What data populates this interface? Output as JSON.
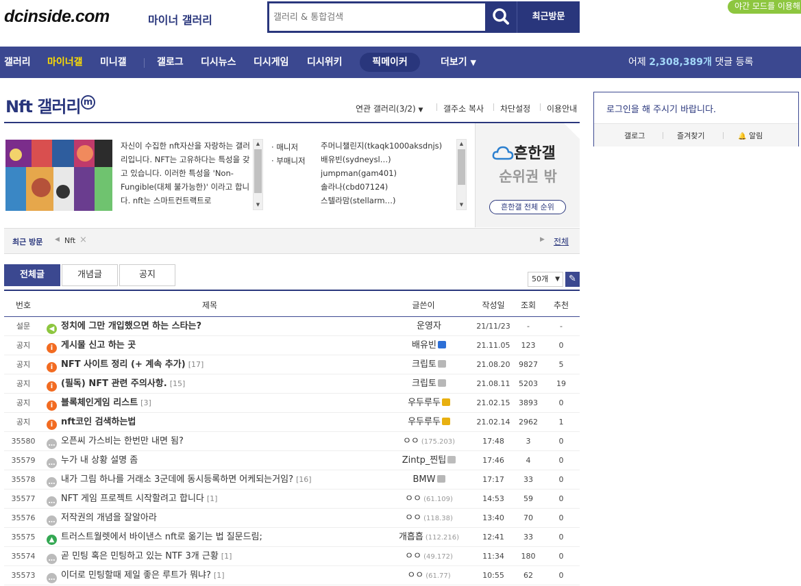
{
  "header": {
    "logo": "dcinside.com",
    "logo_sub": "마이너 갤러리",
    "search_placeholder": "갤러리 & 통합검색",
    "recent_visit_btn": "최근방문",
    "night_mode": "야간 모드를 이용해"
  },
  "nav": {
    "items": [
      "갤러리",
      "마이너갤",
      "미니갤",
      "갤로그",
      "디시뉴스",
      "디시게임",
      "디시위키",
      "픽메이커",
      "더보기"
    ],
    "stat_prefix": "어제",
    "stat_count": "2,308,389개",
    "stat_suffix": "댓글 등록"
  },
  "gallery": {
    "title": "Nft 갤러리",
    "badge": "m",
    "links": [
      "연관 갤러리(3/2)",
      "갤주소 복사",
      "차단설정",
      "이용안내"
    ],
    "description": "자신이 수집한 nft자산을 자랑하는 갤러리입니다. NFT는 고유하다는 특성을 갖고 있습니다. 이러한 특성을 'Non-Fungible(대체 불가능한)' 이라고 합니다. nft는 스마트컨트랙트로",
    "manager_label": "매니저",
    "sub_manager_label": "부매니저",
    "manager_names": [
      "주머니챌린지(tkaqk1000aksdnjs)",
      "배유빈(sydneysl…)",
      "jumpman(gam401)",
      "솔라나(cbd07124)",
      "스텔라맘(stellarm…)"
    ],
    "rank_title": "흔한갤",
    "rank_status": "순위권 밖",
    "rank_button": "흔한갤 전체 순위",
    "rank_help": "?",
    "recent_label": "최근 방문",
    "recent_item": "Nft",
    "recent_all": "전체"
  },
  "tabs": [
    "전체글",
    "개념글",
    "공지"
  ],
  "list_count": "50개",
  "table": {
    "headers": [
      "번호",
      "제목",
      "글쓴이",
      "작성일",
      "조회",
      "추천"
    ],
    "rows": [
      {
        "num": "설문",
        "icon": "survey",
        "title": "정치에 그만 개입했으면 하는 스타는?",
        "comments": "",
        "writer": "운영자",
        "ip": "",
        "badge": "",
        "date": "21/11/23",
        "views": "-",
        "recs": "-",
        "bold": true
      },
      {
        "num": "공지",
        "icon": "notice",
        "title": "게시물 신고 하는 곳",
        "comments": "",
        "writer": "배유빈",
        "ip": "",
        "badge": "blue",
        "date": "21.11.05",
        "views": "123",
        "recs": "0",
        "bold": true
      },
      {
        "num": "공지",
        "icon": "notice",
        "title": "NFT 사이트 정리 (+ 계속 추가)",
        "comments": "[17]",
        "writer": "크립토",
        "ip": "",
        "badge": "gray",
        "date": "21.08.20",
        "views": "9827",
        "recs": "5",
        "bold": true
      },
      {
        "num": "공지",
        "icon": "notice",
        "title": "(필독) NFT 관련 주의사항.",
        "comments": "[15]",
        "writer": "크립토",
        "ip": "",
        "badge": "gray",
        "date": "21.08.11",
        "views": "5203",
        "recs": "19",
        "bold": true
      },
      {
        "num": "공지",
        "icon": "notice",
        "title": "블록체인게임 리스트",
        "comments": "[3]",
        "writer": "우두루두",
        "ip": "",
        "badge": "gold",
        "date": "21.02.15",
        "views": "3893",
        "recs": "0",
        "bold": true
      },
      {
        "num": "공지",
        "icon": "notice",
        "title": "nft코인 검색하는법",
        "comments": "",
        "writer": "우두루두",
        "ip": "",
        "badge": "gold",
        "date": "21.02.14",
        "views": "2962",
        "recs": "1",
        "bold": true
      },
      {
        "num": "35580",
        "icon": "post",
        "title": "오픈씨 가스비는 한번만 내면 됨?",
        "comments": "",
        "writer": "ㅇㅇ",
        "ip": "(175.203)",
        "badge": "",
        "date": "17:48",
        "views": "3",
        "recs": "0",
        "bold": false
      },
      {
        "num": "35579",
        "icon": "post",
        "title": "누가 내 상황 설명 좀",
        "comments": "",
        "writer": "Zintp_찐팁",
        "ip": "",
        "badge": "gray2",
        "date": "17:46",
        "views": "4",
        "recs": "0",
        "bold": false
      },
      {
        "num": "35578",
        "icon": "post",
        "title": "내가 그림 하나를 거래소 3군데에 동시등록하면 어케되는거임?",
        "comments": "[16]",
        "writer": "BMW",
        "ip": "",
        "badge": "gray",
        "date": "17:17",
        "views": "33",
        "recs": "0",
        "bold": false
      },
      {
        "num": "35577",
        "icon": "post",
        "title": "NFT 게임 프로젝트 시작할려고 합니다",
        "comments": "[1]",
        "writer": "ㅇㅇ",
        "ip": "(61.109)",
        "badge": "",
        "date": "14:53",
        "views": "59",
        "recs": "0",
        "bold": false
      },
      {
        "num": "35576",
        "icon": "post",
        "title": "저작권의 개념을 잘알아라",
        "comments": "",
        "writer": "ㅇㅇ",
        "ip": "(118.38)",
        "badge": "",
        "date": "13:40",
        "views": "70",
        "recs": "0",
        "bold": false
      },
      {
        "num": "35575",
        "icon": "image",
        "title": "트러스트월렛에서 바이낸스 nft로 옮기는 법 질문드림;",
        "comments": "",
        "writer": "개흡흡",
        "ip": "(112.216)",
        "badge": "",
        "date": "12:41",
        "views": "33",
        "recs": "0",
        "bold": false
      },
      {
        "num": "35574",
        "icon": "post",
        "title": "곧 민팅 혹은 민팅하고 있는 NTF 3개 근황",
        "comments": "[1]",
        "writer": "ㅇㅇ",
        "ip": "(49.172)",
        "badge": "",
        "date": "11:34",
        "views": "180",
        "recs": "0",
        "bold": false
      },
      {
        "num": "35573",
        "icon": "post",
        "title": "이더로 민팅할때 제일 좋은 루트가 뭐냐?",
        "comments": "[1]",
        "writer": "ㅇㅇ",
        "ip": "(61.77)",
        "badge": "",
        "date": "10:55",
        "views": "62",
        "recs": "0",
        "bold": false
      }
    ]
  },
  "login": {
    "message": "로그인을 해 주시기 바랍니다.",
    "links": [
      "갤로그",
      "즐겨찾기",
      "알림"
    ]
  },
  "colors": {
    "brand": "#29367c",
    "nav_bg": "#3b4890",
    "highlight": "#ffde00",
    "stat": "#a3d8f9",
    "notice_icon": "#f26b21",
    "survey_icon": "#8dc63f",
    "post_icon": "#bbbbbb",
    "image_icon": "#34a853"
  }
}
